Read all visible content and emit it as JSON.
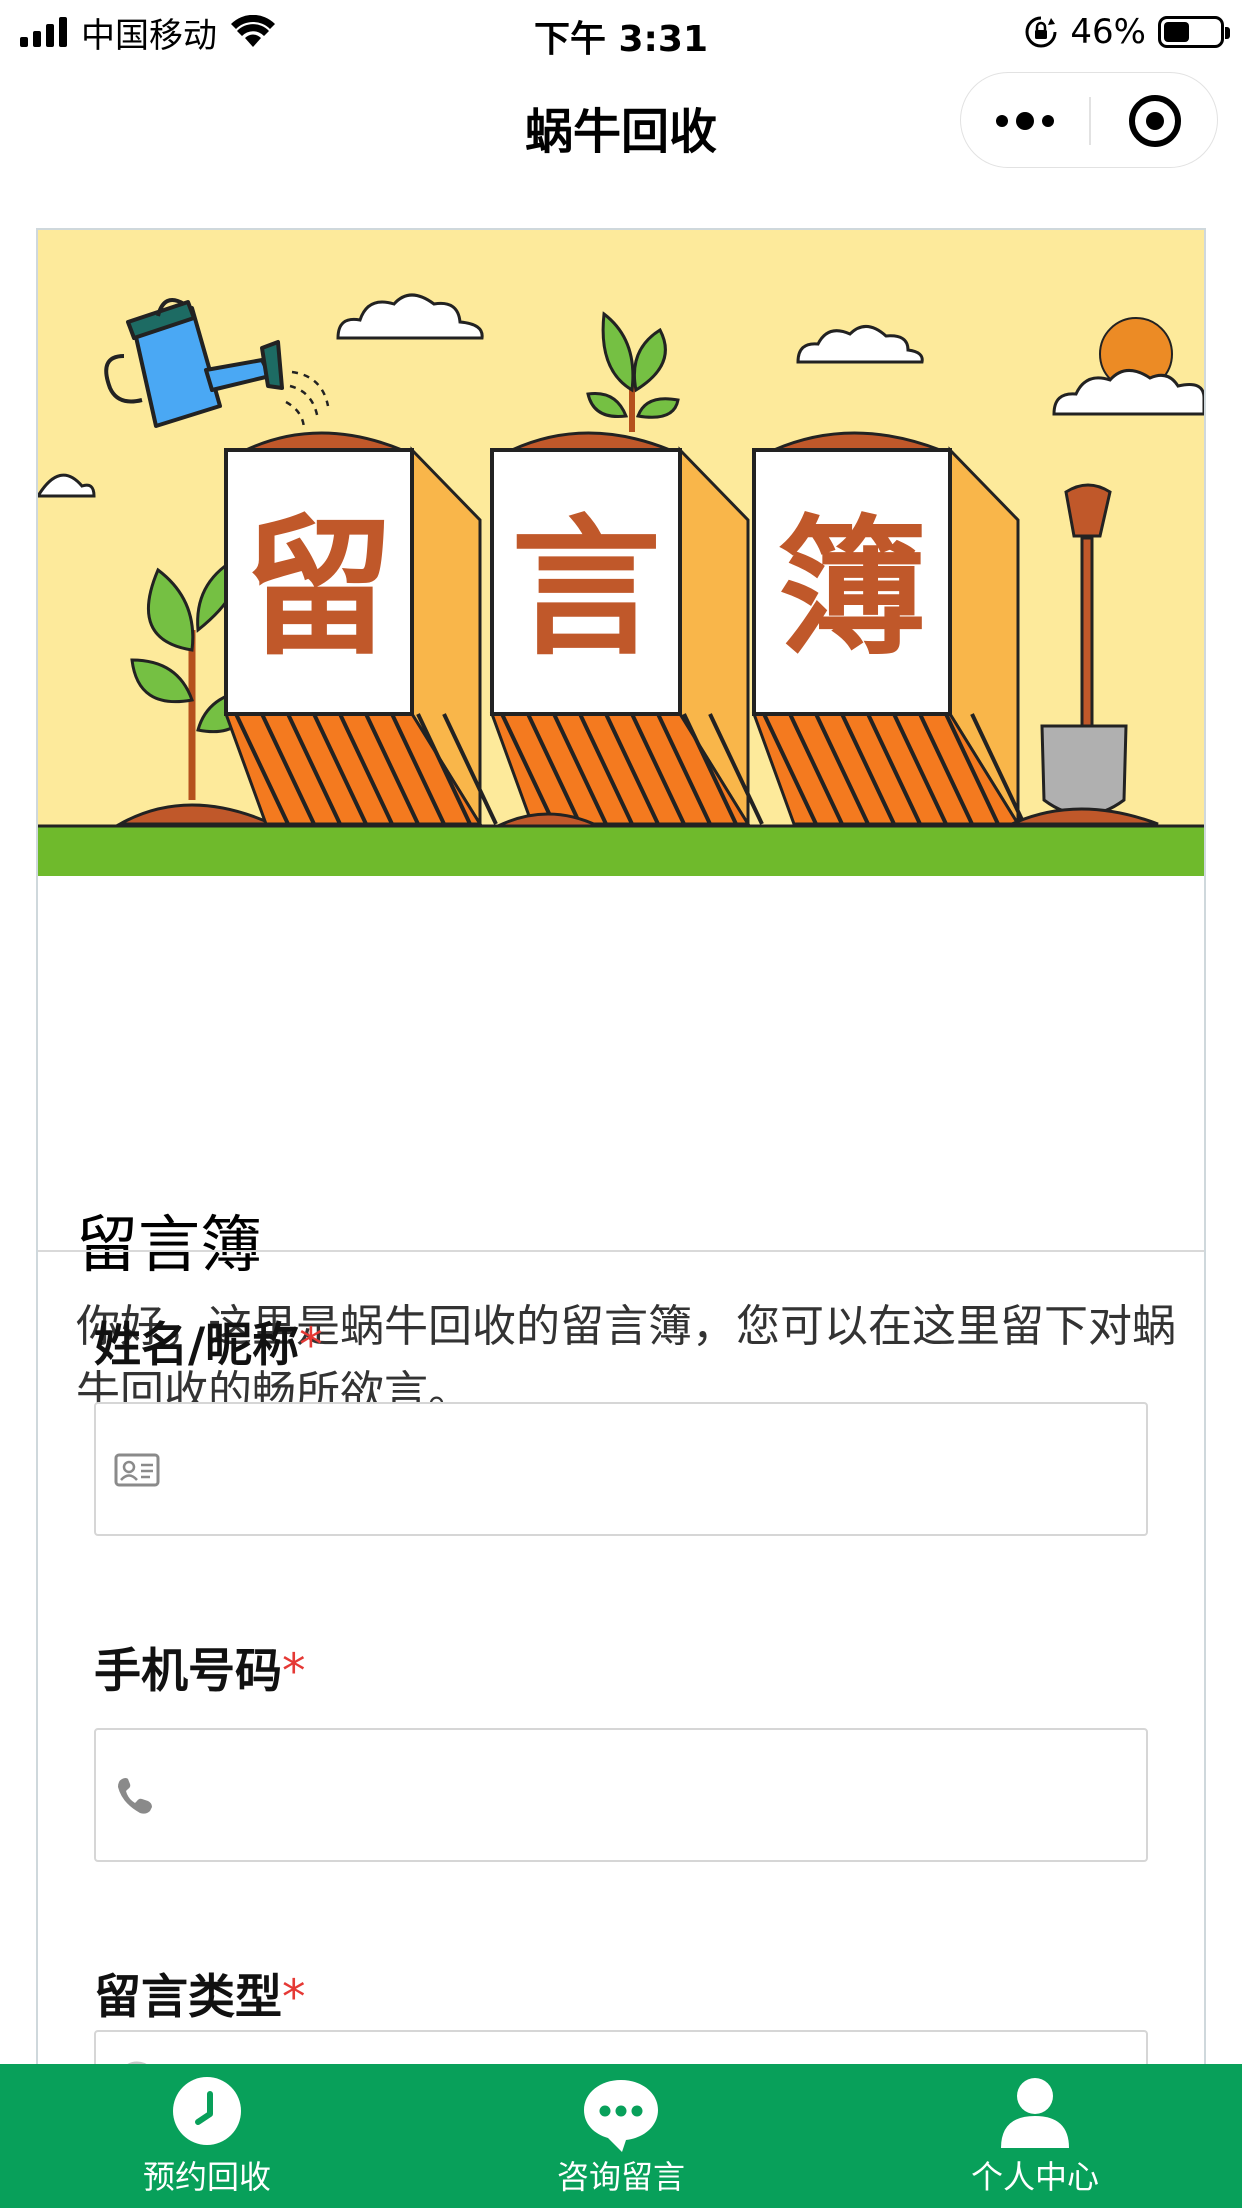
{
  "status_bar": {
    "carrier": "中国移动",
    "time": "下午 3:31",
    "battery": "46%",
    "battery_level": 0.46
  },
  "nav": {
    "title": "蜗牛回收"
  },
  "banner": {
    "chars": [
      "留",
      "言",
      "簿"
    ]
  },
  "intro": {
    "title": "留言簿",
    "description": "你好，这里是蜗牛回收的留言簿，您可以在这里留下对蜗牛回收的畅所欲言。"
  },
  "form": {
    "name_label": "姓名/昵称",
    "phone_label": "手机号码",
    "type_label": "留言类型",
    "required_mark": "*",
    "name_value": "",
    "phone_value": ""
  },
  "tabbar": {
    "items": [
      {
        "label": "预约回收",
        "icon": "clock-icon"
      },
      {
        "label": "咨询留言",
        "icon": "chat-bubble-icon"
      },
      {
        "label": "个人中心",
        "icon": "person-icon"
      }
    ]
  },
  "colors": {
    "brand_green": "#08a05a",
    "banner_yellow": "#fdea9b",
    "banner_grass": "#6fba2c",
    "banner_text": "#c0582a",
    "required": "#e53935"
  }
}
